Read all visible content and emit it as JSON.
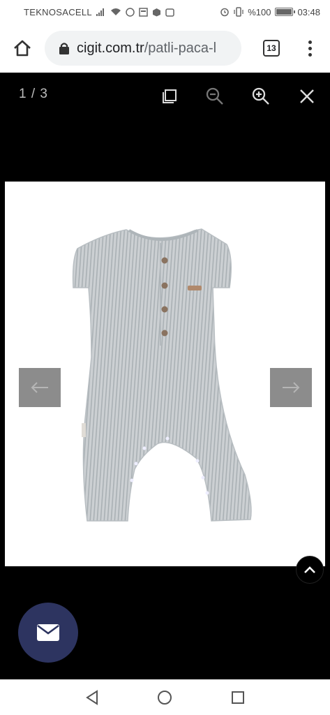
{
  "status_bar": {
    "carrier": "TEKNOSACELL",
    "battery": "%100",
    "time": "03:48"
  },
  "browser": {
    "url_host": "cigit.com.tr",
    "url_path": "/patli-paca-l",
    "tab_count": "13"
  },
  "viewer": {
    "counter": "1 / 3"
  },
  "colors": {
    "fab": "#2d3460",
    "romper": "#c9cdd0",
    "stripe": "#9ea6ab"
  }
}
